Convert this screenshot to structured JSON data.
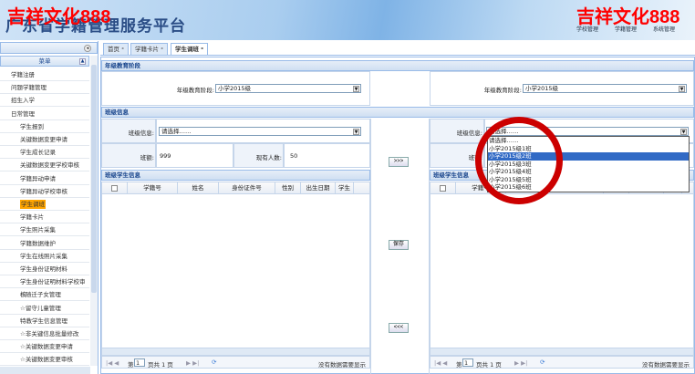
{
  "header": {
    "title": "广东省学籍管理服务平台",
    "watermark": "吉祥文化888",
    "nav": [
      "学校管理",
      "学籍管理",
      "系统管理"
    ]
  },
  "sidebar": {
    "title": "菜单",
    "items": [
      {
        "label": "学籍注册",
        "level": "top"
      },
      {
        "label": "问题学籍管理",
        "level": "top"
      },
      {
        "label": "招生入学",
        "level": "top"
      },
      {
        "label": "日常管理",
        "level": "top"
      },
      {
        "label": "学生报到",
        "level": "sub"
      },
      {
        "label": "关键数据变更申请",
        "level": "sub"
      },
      {
        "label": "学生成长记录",
        "level": "sub"
      },
      {
        "label": "关键数据变更学校审核",
        "level": "sub"
      },
      {
        "label": "学籍异动申请",
        "level": "sub"
      },
      {
        "label": "学籍异动学校审核",
        "level": "sub"
      },
      {
        "label": "学生调班",
        "level": "sub",
        "active": true
      },
      {
        "label": "学籍卡片",
        "level": "sub"
      },
      {
        "label": "学生照片采集",
        "level": "sub"
      },
      {
        "label": "学籍数据维护",
        "level": "sub"
      },
      {
        "label": "学生在线照片采集",
        "level": "sub"
      },
      {
        "label": "学生身份证明材料",
        "level": "sub"
      },
      {
        "label": "学生身份证明材料学校审核",
        "level": "sub"
      },
      {
        "label": "☆随迁子女管理",
        "level": "sub"
      },
      {
        "label": "☆留守儿童管理",
        "level": "sub"
      },
      {
        "label": "特教学生信息管理",
        "level": "sub"
      },
      {
        "label": "☆非关键信息批量修改",
        "level": "sub"
      },
      {
        "label": "☆关键数据变更申请",
        "level": "sub"
      },
      {
        "label": "☆关键数据变更审核",
        "level": "sub"
      }
    ]
  },
  "tabs": [
    {
      "label": "首页"
    },
    {
      "label": "学籍卡片"
    },
    {
      "label": "学生调班",
      "active": true
    }
  ],
  "grade_section": {
    "title": "年级教育阶段",
    "label": "年级教育阶段:",
    "left_value": "小学2015级",
    "right_value": "小学2015级"
  },
  "class_section": {
    "title": "班级信息",
    "class_label": "班级信息:",
    "placeholder": "请选择……",
    "size_label": "班额:",
    "size_value": "999",
    "count_label": "现有人数:",
    "count_value": "50",
    "right_size_label": "班额:"
  },
  "dropdown_options": [
    "请选择……",
    "小学2015级1班",
    "小学2015级2班",
    "小学2015级3班",
    "小学2015级4班",
    "小学2015级5班",
    "小学2015级6班"
  ],
  "dropdown_highlighted": 2,
  "students": {
    "title": "班级学生信息",
    "columns": [
      "学籍号",
      "姓名",
      "身份证件号",
      "性别",
      "出生日期",
      "学生"
    ]
  },
  "buttons": {
    "move_right": ">>>",
    "save": "保存",
    "move_left": "<<<"
  },
  "pager": {
    "page_prefix": "第",
    "page": "1",
    "page_suffix": "页共 1 页",
    "empty": "没有数据需要显示"
  },
  "colors": {
    "accent": "#15428b",
    "highlight": "#316ac5",
    "active_menu": "#ffa500",
    "watermark": "#ff0000"
  }
}
